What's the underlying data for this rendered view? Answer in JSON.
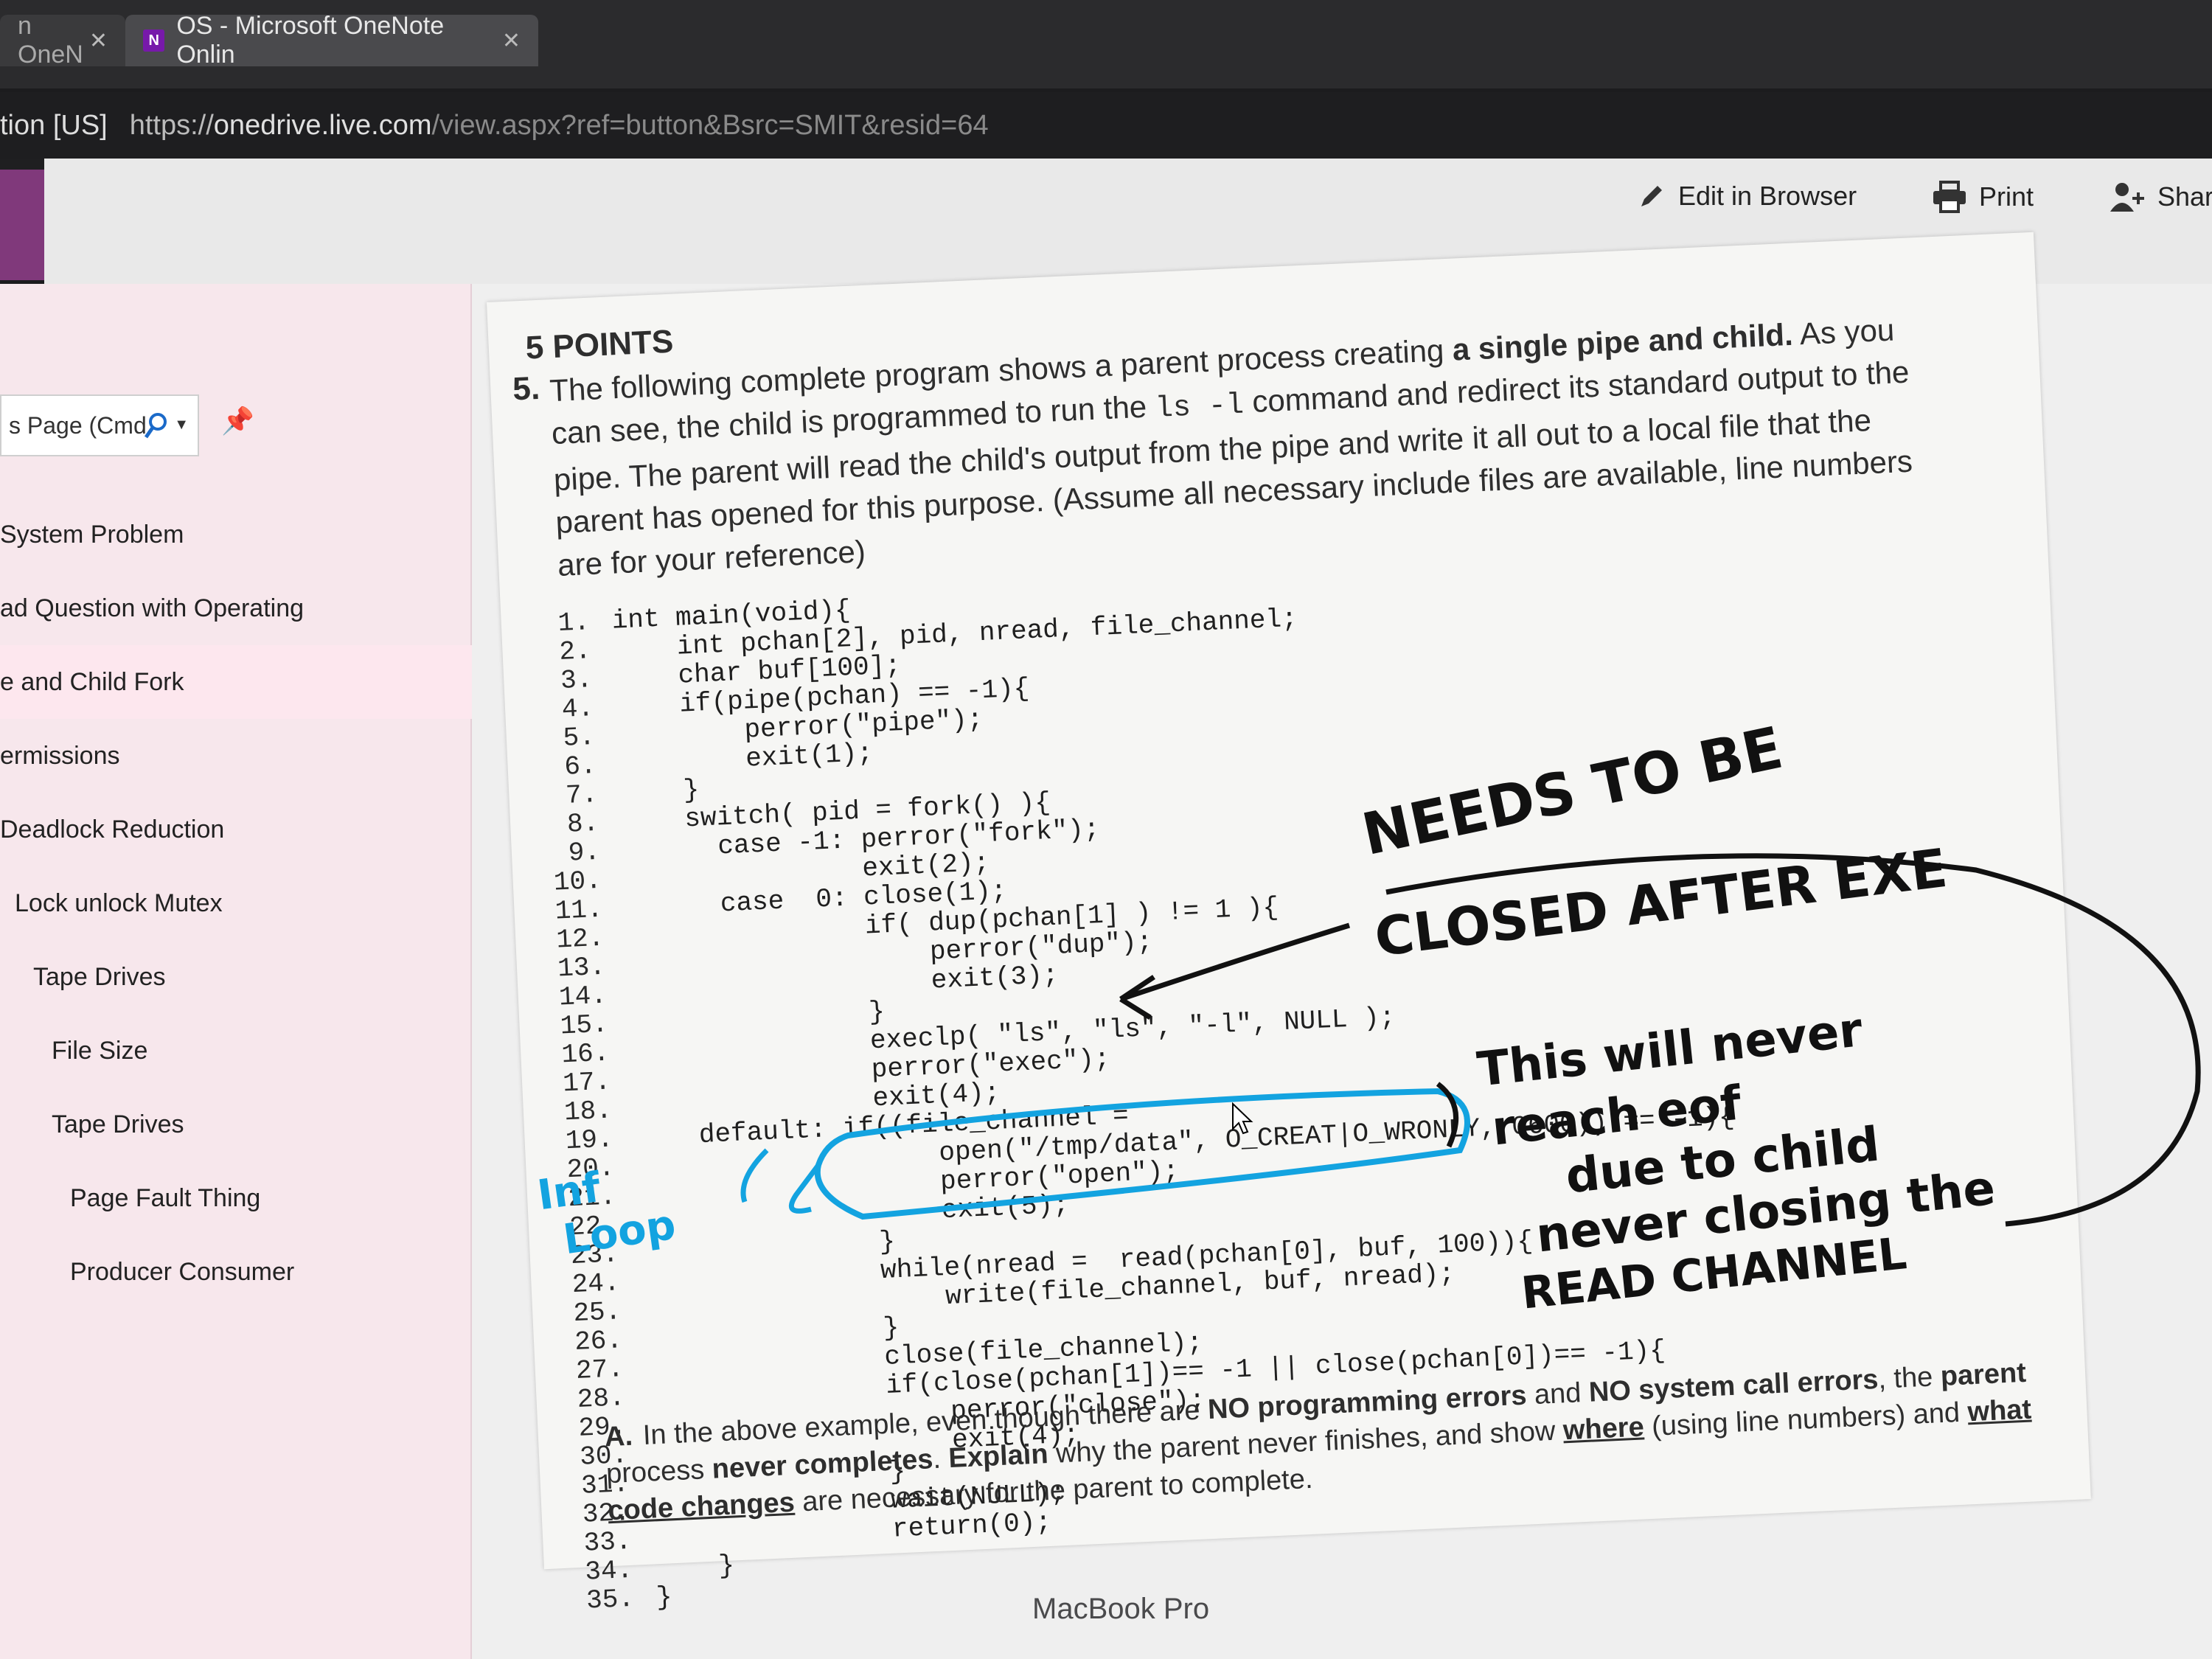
{
  "browser": {
    "tabs": [
      {
        "label": "n OneN",
        "active": false
      },
      {
        "label": "OS - Microsoft OneNote Onlin",
        "active": true
      }
    ],
    "site_identity": "tion [US]",
    "url": {
      "scheme": "https://",
      "host": "onedrive.live.com",
      "path": "/view.aspx?ref=button&Bsrc=SMIT&resid=64"
    }
  },
  "toolbar": {
    "edit_label": "Edit in Browser",
    "print_label": "Print",
    "share_label": "Share"
  },
  "notebook_title": "OS",
  "sidebar": {
    "search_placeholder": "s Page (Cmd",
    "pages": [
      {
        "label": "System Problem",
        "level": 0
      },
      {
        "label": "ad Question with Operating",
        "level": 0
      },
      {
        "label": "e and Child Fork",
        "level": 0,
        "selected": true
      },
      {
        "label": "ermissions",
        "level": 0
      },
      {
        "label": "Deadlock Reduction",
        "level": 0
      },
      {
        "label": "Lock unlock Mutex",
        "level": 1
      },
      {
        "label": "Tape Drives",
        "level": 2
      },
      {
        "label": "File Size",
        "level": 3
      },
      {
        "label": "Tape Drives",
        "level": 3
      },
      {
        "label": "Page Fault Thing",
        "level": 4
      },
      {
        "label": "Producer Consumer",
        "level": 4
      }
    ]
  },
  "question": {
    "points": "5 POINTS",
    "number": "5.",
    "text_1": "The following complete program shows a parent process creating ",
    "text_bold": "a single pipe and child.",
    "text_2": " As you can see, the child is programmed to run the ",
    "command": "ls -l",
    "text_3": " command and redirect its standard output to the pipe. The parent will read the child's output from the pipe and write it all out to a local file that the parent has opened for this purpose. (Assume all necessary include files are available, line numbers are for your reference)",
    "code": [
      {
        "n": "1.",
        "t": "int main(void){"
      },
      {
        "n": "2.",
        "t": "    int pchan[2], pid, nread, file_channel;"
      },
      {
        "n": "3.",
        "t": "    char buf[100];"
      },
      {
        "n": "4.",
        "t": "    if(pipe(pchan) == -1){"
      },
      {
        "n": "5.",
        "t": "        perror(\"pipe\");"
      },
      {
        "n": "6.",
        "t": "        exit(1);"
      },
      {
        "n": "7.",
        "t": "    }"
      },
      {
        "n": "8.",
        "t": "    switch( pid = fork() ){"
      },
      {
        "n": "9.",
        "t": "      case -1: perror(\"fork\");"
      },
      {
        "n": "10.",
        "t": "               exit(2);"
      },
      {
        "n": "11.",
        "t": "      case  0: close(1);"
      },
      {
        "n": "12.",
        "t": "               if( dup(pchan[1] ) != 1 ){"
      },
      {
        "n": "13.",
        "t": "                   perror(\"dup\");"
      },
      {
        "n": "14.",
        "t": "                   exit(3);"
      },
      {
        "n": "15.",
        "t": "               }"
      },
      {
        "n": "16.",
        "t": "               execlp( \"ls\", \"ls\", \"-l\", NULL );"
      },
      {
        "n": "17.",
        "t": "               perror(\"exec\");"
      },
      {
        "n": "18.",
        "t": "               exit(4);"
      },
      {
        "n": "19.",
        "t": "    default: if((file_channel ="
      },
      {
        "n": "20.",
        "t": "                   open(\"/tmp/data\", O_CREAT|O_WRONLY, 0600)) == -1){"
      },
      {
        "n": "21.",
        "t": "                   perror(\"open\");"
      },
      {
        "n": "22.",
        "t": "                   exit(5);"
      },
      {
        "n": "23.",
        "t": "               }"
      },
      {
        "n": "24.",
        "t": "               while(nread =  read(pchan[0], buf, 100)){"
      },
      {
        "n": "25.",
        "t": "                   write(file_channel, buf, nread);"
      },
      {
        "n": "26.",
        "t": "               }"
      },
      {
        "n": "27.",
        "t": "               close(file_channel);"
      },
      {
        "n": "28.",
        "t": "               if(close(pchan[1])== -1 || close(pchan[0])== -1){"
      },
      {
        "n": "29.",
        "t": "                   perror(\"close\");"
      },
      {
        "n": "30.",
        "t": "                   exit(4);"
      },
      {
        "n": "31.",
        "t": "               }"
      },
      {
        "n": "32.",
        "t": "               wait(NULL);"
      },
      {
        "n": "33.",
        "t": "               return(0);"
      },
      {
        "n": "34.",
        "t": "    }"
      },
      {
        "n": "35.",
        "t": "}"
      }
    ],
    "part_a": {
      "label": "A.",
      "text_1": "In the above example, even though there are ",
      "bold_1": "NO programming errors",
      "text_2": " and ",
      "bold_2": "NO system call errors",
      "text_3": ", the ",
      "bold_3": "parent",
      "text_4": " process ",
      "bold_4": "never completes",
      "text_5": ". ",
      "bold_5": "Explain",
      "text_6": " why the parent never finishes, and show ",
      "underline_1": "where",
      "text_7": " (using line numbers) and ",
      "underline_2": "what code changes",
      "text_8": " are necessary for the parent to complete."
    }
  },
  "annotations": {
    "black_top_1": "NEEDS TO BE",
    "black_top_2": "CLOSED AFTER EXE",
    "black_note": [
      "This will never",
      "reach eof",
      "due to child",
      "never closing the",
      "READ CHANNEL"
    ],
    "blue_note": [
      "Inf",
      "Loop"
    ]
  },
  "colors": {
    "annotation_blue": "#13a3e0",
    "annotation_black": "#111111",
    "onenote_purple": "#7719aa"
  },
  "device_label": "MacBook Pro"
}
